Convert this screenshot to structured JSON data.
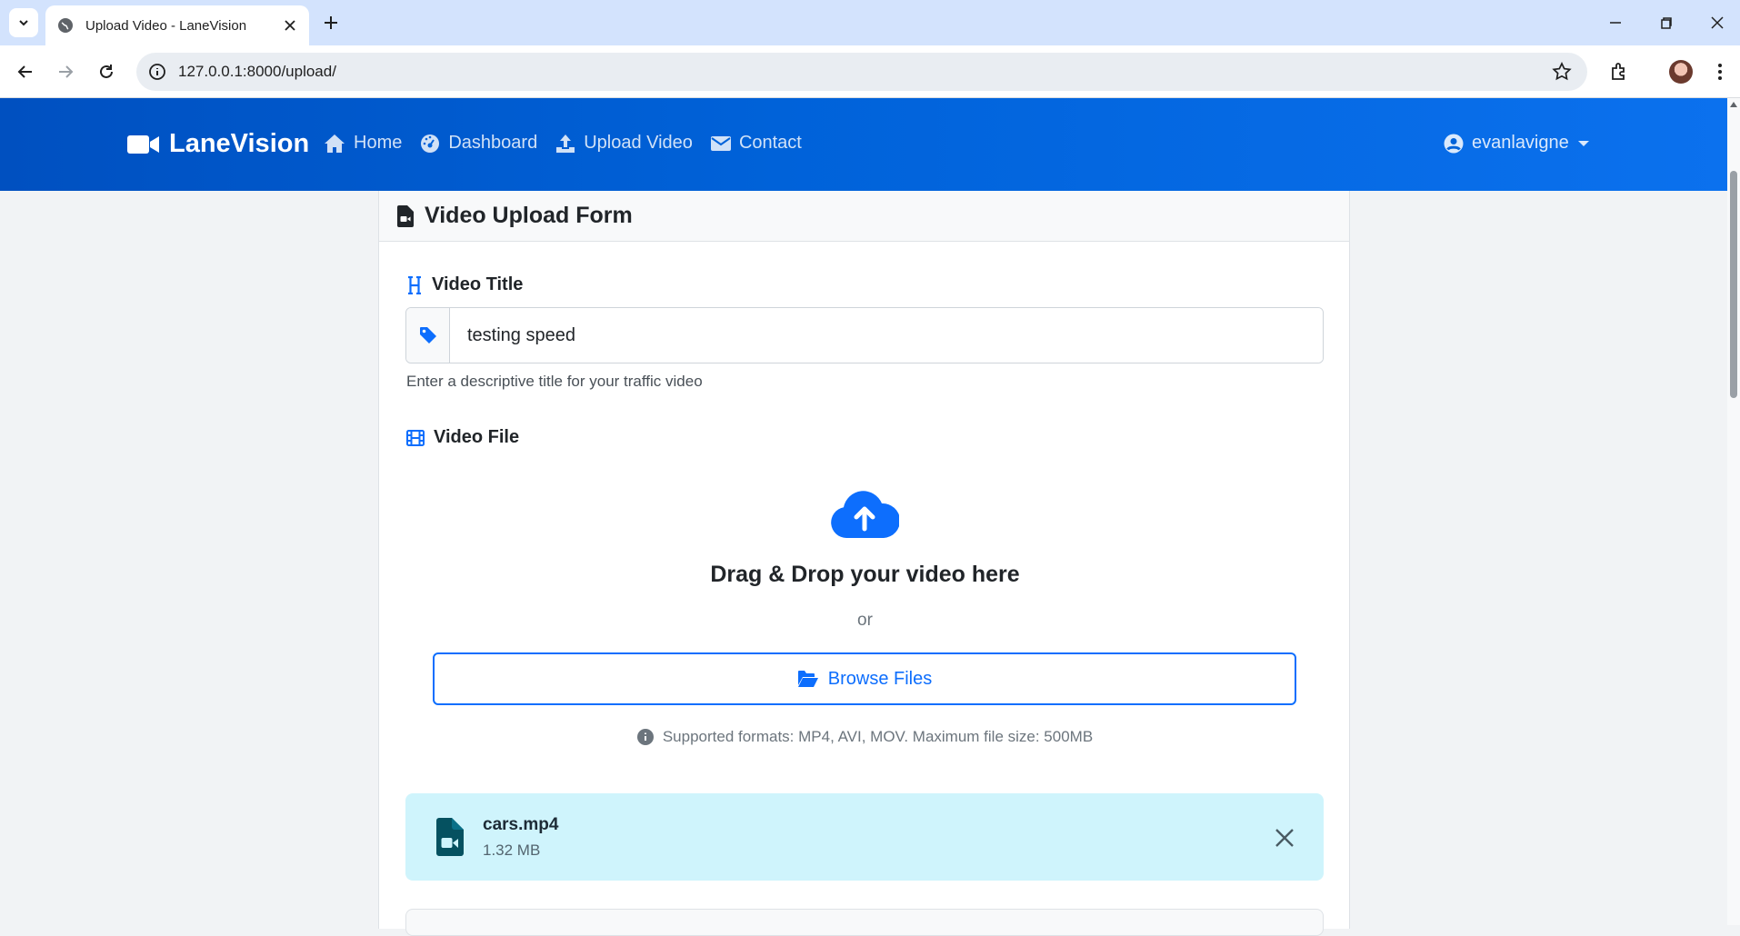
{
  "browser": {
    "tab_title": "Upload Video - LaneVision",
    "url": "127.0.0.1:8000/upload/"
  },
  "navbar": {
    "brand": "LaneVision",
    "links": [
      {
        "label": "Home",
        "icon": "house-icon"
      },
      {
        "label": "Dashboard",
        "icon": "gauge-icon"
      },
      {
        "label": "Upload Video",
        "icon": "upload-icon"
      },
      {
        "label": "Contact",
        "icon": "envelope-icon"
      }
    ],
    "user": "evanlavigne"
  },
  "form": {
    "header": "Video Upload Form",
    "title_label": "Video Title",
    "title_value": "testing speed",
    "title_help": "Enter a descriptive title for your traffic video",
    "file_label": "Video File",
    "drop_text": "Drag & Drop your video here",
    "or_text": "or",
    "browse_label": "Browse Files",
    "formats_text": "Supported formats: MP4, AVI, MOV. Maximum file size: 500MB"
  },
  "selected_file": {
    "name": "cars.mp4",
    "size": "1.32 MB"
  },
  "colors": {
    "primary": "#0d6efd",
    "navbar": "#0062d9",
    "file_box": "#cff4fc",
    "file_icon": "#055160"
  }
}
